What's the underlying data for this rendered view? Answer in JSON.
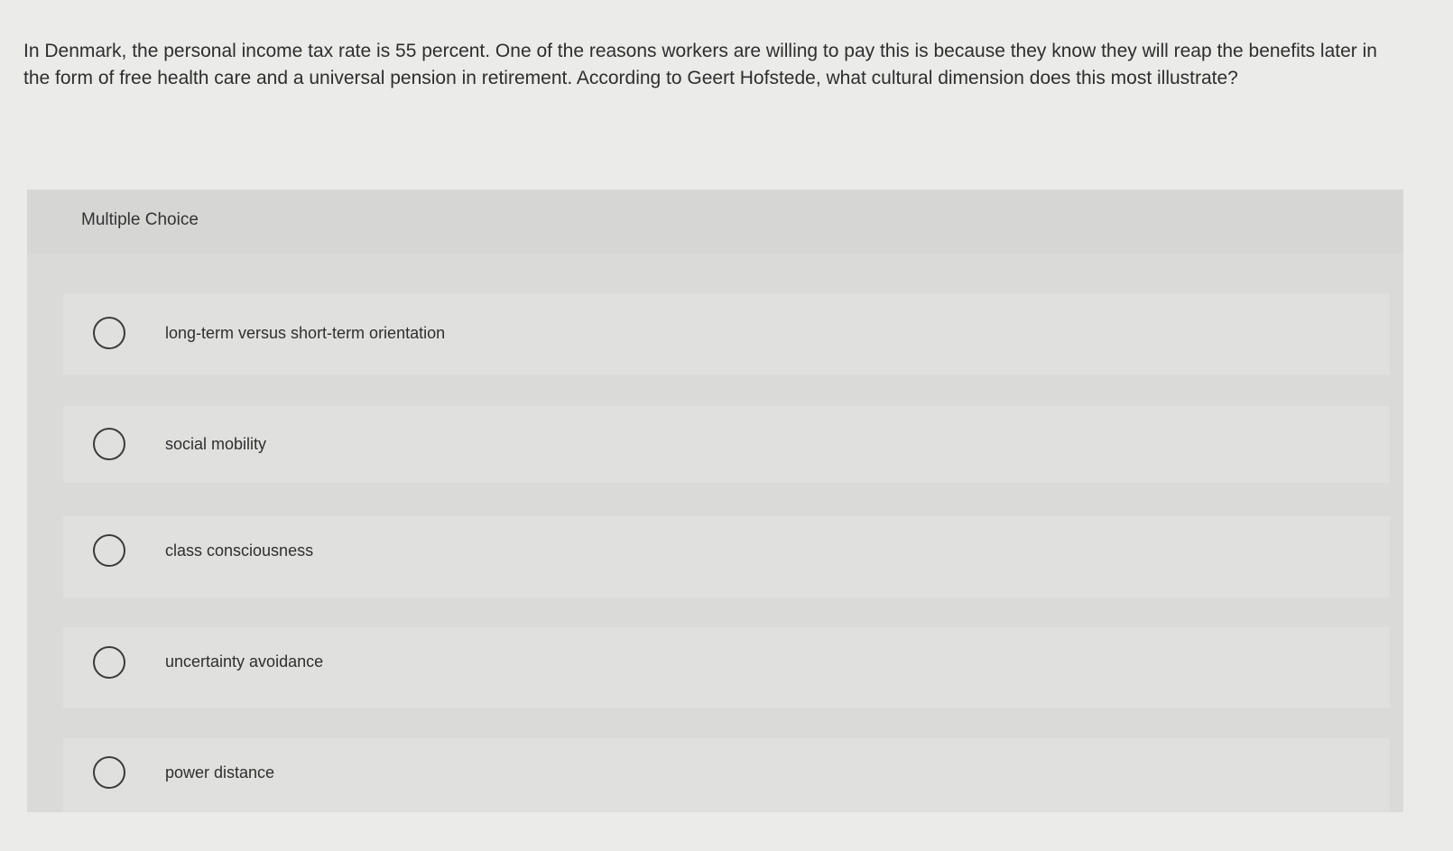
{
  "question": {
    "text": "In Denmark, the personal income tax rate is 55 percent. One of the reasons workers are willing to pay this is because they know they will reap the benefits later in the form of free health care and a universal pension in retirement. According to Geert Hofstede, what cultural dimension does this most illustrate?"
  },
  "multiple_choice": {
    "label": "Multiple Choice",
    "options": [
      {
        "label": "long-term versus short-term orientation"
      },
      {
        "label": "social mobility"
      },
      {
        "label": "class consciousness"
      },
      {
        "label": "uncertainty avoidance"
      },
      {
        "label": "power distance"
      }
    ]
  }
}
